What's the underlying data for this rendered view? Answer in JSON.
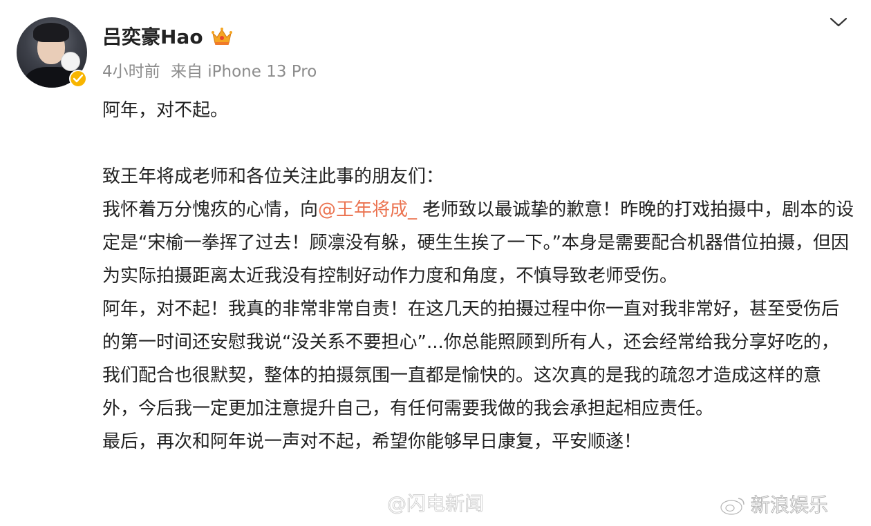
{
  "post": {
    "author": "吕奕豪Hao",
    "time": "4小时前",
    "source": "来自 iPhone 13 Pro",
    "body": {
      "line1": "阿年，对不起。",
      "line2": "致王年将成老师和各位关注此事的朋友们：",
      "para1_pre": "我怀着万分愧疚的心情，向",
      "mention": "@王年将成_",
      "para1_post": "老师致以最诚挚的歉意！昨晚的打戏拍摄中，剧本的设定是“宋榆一拳挥了过去！顾凛没有躲，硬生生挨了一下。”本身是需要配合机器借位拍摄，但因为实际拍摄距离太近我没有控制好动作力度和角度，不慎导致老师受伤。",
      "para2": "阿年，对不起！我真的非常非常自责！在这几天的拍摄过程中你一直对我非常好，甚至受伤后的第一时间还安慰我说“没关系不要担心”...你总能照顾到所有人，还会经常给我分享好吃的，我们配合也很默契，整体的拍摄氛围一直都是愉快的。这次真的是我的疏忽才造成这样的意外，今后我一定更加注意提升自己，有任何需要我做的我会承担起相应责任。",
      "para3": "最后，再次和阿年说一声对不起，希望你能够早日康复，平安顺遂！"
    }
  },
  "watermark": {
    "text": "新浪娱乐",
    "text2": "@闪电新闻"
  },
  "icons": {
    "avatar": "user-avatar",
    "verified": "verified-badge-icon",
    "crown": "crown-icon",
    "expand": "chevron-down-icon",
    "watermark": "weibo-logo-icon"
  },
  "colors": {
    "mention": "#eb7350",
    "meta": "#8c8c8c",
    "verified": "#f8b500"
  }
}
